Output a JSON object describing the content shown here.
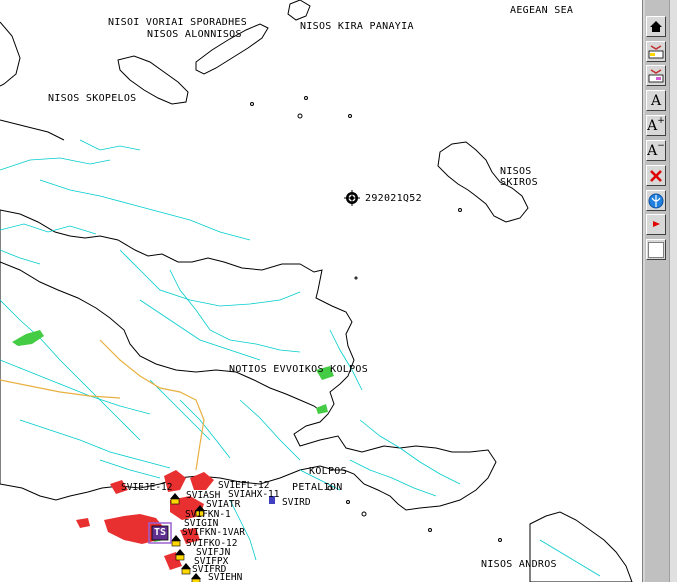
{
  "map": {
    "sea_labels": [
      {
        "id": "aegean",
        "text": "AEGEAN SEA"
      },
      {
        "id": "voriai",
        "text": "NISOI VORIAI SPORADHES"
      },
      {
        "id": "alonnisos",
        "text": "NISOS ALONNISOS"
      },
      {
        "id": "kira",
        "text": "NISOS KIRA PANAYIA"
      },
      {
        "id": "skopelos",
        "text": "NISOS SKOPELOS"
      },
      {
        "id": "skiros1",
        "text": "NISOS"
      },
      {
        "id": "skiros2",
        "text": "SKIROS"
      },
      {
        "id": "evvoikos",
        "text": "NOTIOS EVVOIKOS KOLPOS"
      },
      {
        "id": "kolpos",
        "text": "KOLPOS"
      },
      {
        "id": "petalion",
        "text": "PETALION"
      },
      {
        "id": "andros",
        "text": "NISOS ANDROS"
      }
    ],
    "contact_id": "292021Q52",
    "stations": [
      "SVIEFL-12",
      "SVIEJE-12",
      "SVIASH",
      "SVIAHX-11",
      "SVIATR",
      "SVIRD",
      "SVIFKN-1",
      "SVIGIN",
      "SVIFKN-1VAR",
      "SVIFKO-12",
      "SVIFJN",
      "SVIFPX",
      "SVIFRD",
      "SVIEHN",
      "TS"
    ],
    "colors": {
      "land_lines": "#00cccc",
      "roads": "#e8b040",
      "urban": "#e83030",
      "vegetation": "#44cc44",
      "coast": "#000000"
    }
  },
  "toolbar": {
    "buttons": [
      {
        "name": "home-button",
        "icon": "home-icon",
        "label": ""
      },
      {
        "name": "layer-button-1",
        "icon": "map-layer-icon",
        "label": ""
      },
      {
        "name": "layer-button-2",
        "icon": "map-layer-icon",
        "label": ""
      },
      {
        "name": "font-button",
        "icon": "font-icon",
        "label": "A"
      },
      {
        "name": "font-increase-button",
        "icon": "font-increase-icon",
        "label": "A"
      },
      {
        "name": "font-decrease-button",
        "icon": "font-decrease-icon",
        "label": "A"
      },
      {
        "name": "delete-button",
        "icon": "close-icon",
        "label": ""
      },
      {
        "name": "globe-button",
        "icon": "globe-icon",
        "label": ""
      },
      {
        "name": "flag-button",
        "icon": "flag-icon",
        "label": ""
      },
      {
        "name": "blank-button",
        "icon": "blank-icon",
        "label": ""
      }
    ]
  }
}
